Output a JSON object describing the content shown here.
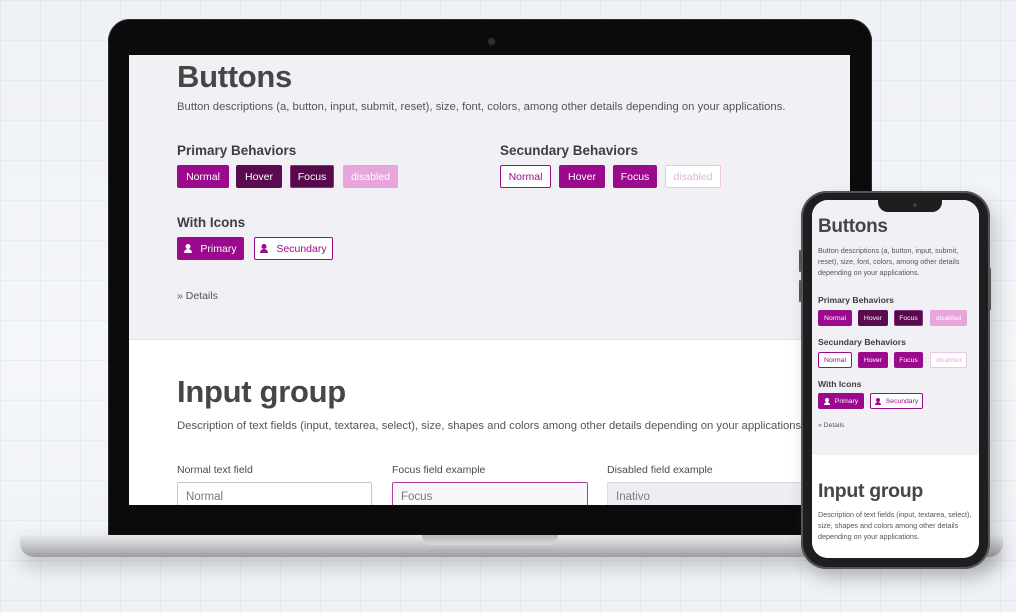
{
  "buttons_section": {
    "title": "Buttons",
    "description": "Button descriptions (a, button, input, submit, reset), size, font, colors, among other details depending on your applications.",
    "primary_heading": "Primary Behaviors",
    "primary_buttons": [
      "Normal",
      "Hover",
      "Focus",
      "disabled"
    ],
    "secondary_heading": "Secundary Behaviors",
    "secondary_buttons": [
      "Normal",
      "Hover",
      "Focus",
      "disabled"
    ],
    "icons_heading": "With Icons",
    "icon_buttons": [
      "Primary",
      "Secundary"
    ],
    "details_link": "» Details"
  },
  "input_section": {
    "title": "Input group",
    "description": "Description of text fields (input, textarea, select), size, shapes and colors among other details depending on your applications.",
    "fields": [
      {
        "label": "Normal text field",
        "value": "Normal"
      },
      {
        "label": "Focus field example",
        "value": "Focus"
      },
      {
        "label": "Disabled field example",
        "value": "Inativo"
      }
    ]
  },
  "mobile": {
    "buttons_description": "Button descriptions (a, button, input, submit, reset), size, font, colors, among other details depending on your applications.",
    "input_description": "Description of text fields (input, textarea, select), size, shapes and colors among other details depending on your applications."
  },
  "colors": {
    "primary": "#9b0a8c",
    "primary_dark": "#5a0a4f",
    "primary_disabled": "#e8a5dc",
    "section_bg": "#f1f1f5"
  },
  "icons": {
    "button_icon": "person-icon",
    "laptop_camera": "camera-dot"
  }
}
